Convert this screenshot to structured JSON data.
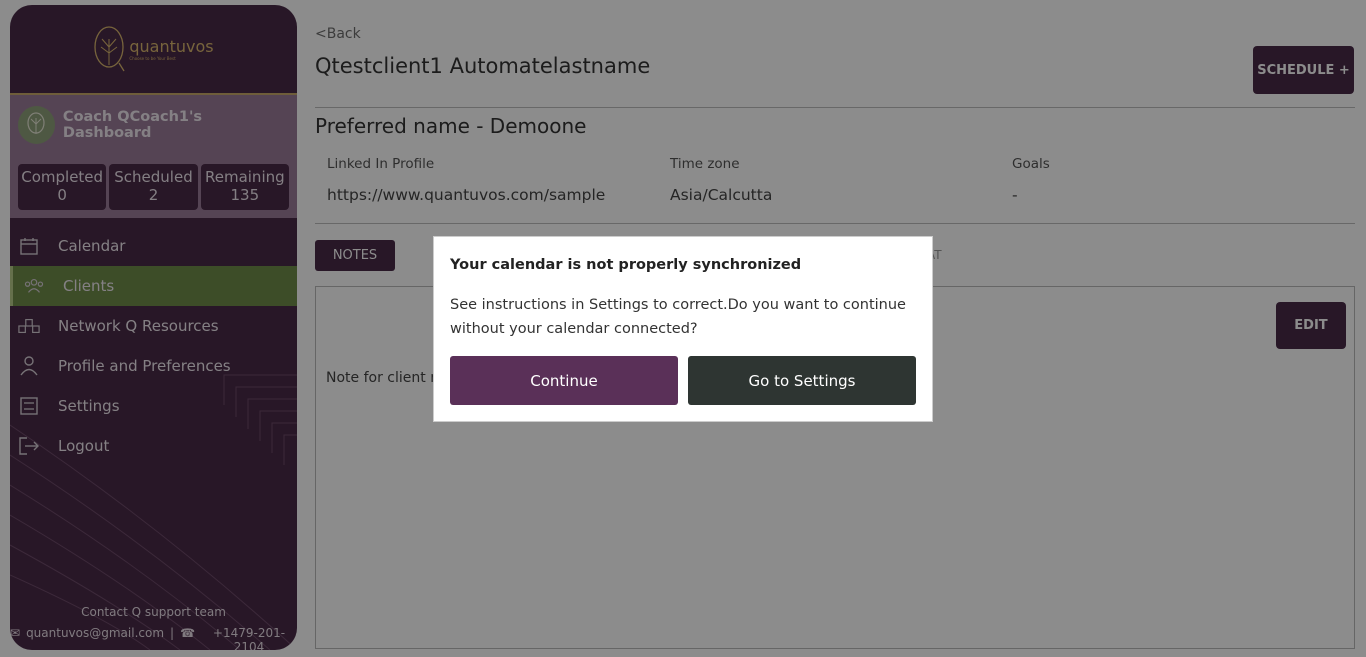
{
  "sidebar": {
    "logo_text": "quantuvos",
    "logo_tagline": "Choose to be Your Best",
    "coach_title": "Coach QCoach1's Dashboard",
    "stats": [
      {
        "label": "Completed",
        "value": "0"
      },
      {
        "label": "Scheduled",
        "value": "2"
      },
      {
        "label": "Remaining",
        "value": "135"
      }
    ],
    "items": [
      {
        "label": "Calendar",
        "icon": "calendar-icon"
      },
      {
        "label": "Clients",
        "icon": "users-icon"
      },
      {
        "label": "Network Q Resources",
        "icon": "network-icon"
      },
      {
        "label": "Profile and Preferences",
        "icon": "person-icon"
      },
      {
        "label": "Settings",
        "icon": "settings-icon"
      },
      {
        "label": "Logout",
        "icon": "logout-icon"
      }
    ],
    "contact_title": "Contact Q support team",
    "contact_email": "quantuvos@gmail.com",
    "contact_phone": "+1479-201-2104"
  },
  "main": {
    "back": "<Back",
    "client_name": "Qtestclient1 Automatelastname",
    "schedule_label": "SCHEDULE +",
    "preferred_name": "Preferred name  - Demoone",
    "linkedin_label": "Linked In Profile",
    "linkedin_value": "https://www.quantuvos.com/sample",
    "timezone_label": "Time zone",
    "timezone_value": "Asia/Calcutta",
    "goals_label": "Goals",
    "goals_value": "-",
    "tab_notes": "NOTES",
    "tab_chat": "AT",
    "edit_label": "EDIT",
    "note_text": "Note for client n"
  },
  "modal": {
    "title": "Your calendar is not properly synchronized",
    "body": "See instructions in Settings to correct.Do you want to continue without your calendar connected?",
    "continue_label": "Continue",
    "settings_label": "Go to Settings"
  },
  "colors": {
    "brand": "#4a2a47",
    "active": "#6f8d4a",
    "gold": "#d9b66e"
  }
}
